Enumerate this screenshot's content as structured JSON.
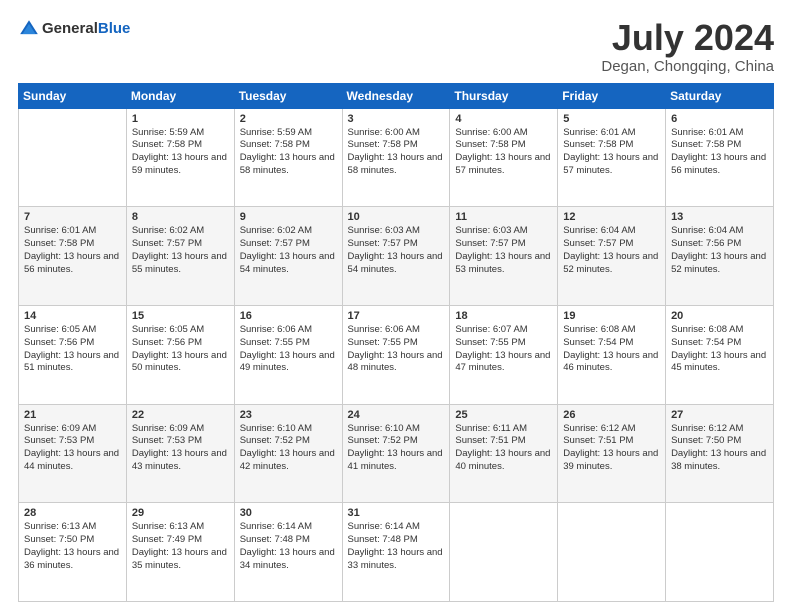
{
  "header": {
    "logo_line1": "General",
    "logo_line2": "Blue",
    "month_title": "July 2024",
    "location": "Degan, Chongqing, China"
  },
  "weekdays": [
    "Sunday",
    "Monday",
    "Tuesday",
    "Wednesday",
    "Thursday",
    "Friday",
    "Saturday"
  ],
  "weeks": [
    [
      {
        "day": "",
        "sunrise": "",
        "sunset": "",
        "daylight": ""
      },
      {
        "day": "1",
        "sunrise": "Sunrise: 5:59 AM",
        "sunset": "Sunset: 7:58 PM",
        "daylight": "Daylight: 13 hours and 59 minutes."
      },
      {
        "day": "2",
        "sunrise": "Sunrise: 5:59 AM",
        "sunset": "Sunset: 7:58 PM",
        "daylight": "Daylight: 13 hours and 58 minutes."
      },
      {
        "day": "3",
        "sunrise": "Sunrise: 6:00 AM",
        "sunset": "Sunset: 7:58 PM",
        "daylight": "Daylight: 13 hours and 58 minutes."
      },
      {
        "day": "4",
        "sunrise": "Sunrise: 6:00 AM",
        "sunset": "Sunset: 7:58 PM",
        "daylight": "Daylight: 13 hours and 57 minutes."
      },
      {
        "day": "5",
        "sunrise": "Sunrise: 6:01 AM",
        "sunset": "Sunset: 7:58 PM",
        "daylight": "Daylight: 13 hours and 57 minutes."
      },
      {
        "day": "6",
        "sunrise": "Sunrise: 6:01 AM",
        "sunset": "Sunset: 7:58 PM",
        "daylight": "Daylight: 13 hours and 56 minutes."
      }
    ],
    [
      {
        "day": "7",
        "sunrise": "Sunrise: 6:01 AM",
        "sunset": "Sunset: 7:58 PM",
        "daylight": "Daylight: 13 hours and 56 minutes."
      },
      {
        "day": "8",
        "sunrise": "Sunrise: 6:02 AM",
        "sunset": "Sunset: 7:57 PM",
        "daylight": "Daylight: 13 hours and 55 minutes."
      },
      {
        "day": "9",
        "sunrise": "Sunrise: 6:02 AM",
        "sunset": "Sunset: 7:57 PM",
        "daylight": "Daylight: 13 hours and 54 minutes."
      },
      {
        "day": "10",
        "sunrise": "Sunrise: 6:03 AM",
        "sunset": "Sunset: 7:57 PM",
        "daylight": "Daylight: 13 hours and 54 minutes."
      },
      {
        "day": "11",
        "sunrise": "Sunrise: 6:03 AM",
        "sunset": "Sunset: 7:57 PM",
        "daylight": "Daylight: 13 hours and 53 minutes."
      },
      {
        "day": "12",
        "sunrise": "Sunrise: 6:04 AM",
        "sunset": "Sunset: 7:57 PM",
        "daylight": "Daylight: 13 hours and 52 minutes."
      },
      {
        "day": "13",
        "sunrise": "Sunrise: 6:04 AM",
        "sunset": "Sunset: 7:56 PM",
        "daylight": "Daylight: 13 hours and 52 minutes."
      }
    ],
    [
      {
        "day": "14",
        "sunrise": "Sunrise: 6:05 AM",
        "sunset": "Sunset: 7:56 PM",
        "daylight": "Daylight: 13 hours and 51 minutes."
      },
      {
        "day": "15",
        "sunrise": "Sunrise: 6:05 AM",
        "sunset": "Sunset: 7:56 PM",
        "daylight": "Daylight: 13 hours and 50 minutes."
      },
      {
        "day": "16",
        "sunrise": "Sunrise: 6:06 AM",
        "sunset": "Sunset: 7:55 PM",
        "daylight": "Daylight: 13 hours and 49 minutes."
      },
      {
        "day": "17",
        "sunrise": "Sunrise: 6:06 AM",
        "sunset": "Sunset: 7:55 PM",
        "daylight": "Daylight: 13 hours and 48 minutes."
      },
      {
        "day": "18",
        "sunrise": "Sunrise: 6:07 AM",
        "sunset": "Sunset: 7:55 PM",
        "daylight": "Daylight: 13 hours and 47 minutes."
      },
      {
        "day": "19",
        "sunrise": "Sunrise: 6:08 AM",
        "sunset": "Sunset: 7:54 PM",
        "daylight": "Daylight: 13 hours and 46 minutes."
      },
      {
        "day": "20",
        "sunrise": "Sunrise: 6:08 AM",
        "sunset": "Sunset: 7:54 PM",
        "daylight": "Daylight: 13 hours and 45 minutes."
      }
    ],
    [
      {
        "day": "21",
        "sunrise": "Sunrise: 6:09 AM",
        "sunset": "Sunset: 7:53 PM",
        "daylight": "Daylight: 13 hours and 44 minutes."
      },
      {
        "day": "22",
        "sunrise": "Sunrise: 6:09 AM",
        "sunset": "Sunset: 7:53 PM",
        "daylight": "Daylight: 13 hours and 43 minutes."
      },
      {
        "day": "23",
        "sunrise": "Sunrise: 6:10 AM",
        "sunset": "Sunset: 7:52 PM",
        "daylight": "Daylight: 13 hours and 42 minutes."
      },
      {
        "day": "24",
        "sunrise": "Sunrise: 6:10 AM",
        "sunset": "Sunset: 7:52 PM",
        "daylight": "Daylight: 13 hours and 41 minutes."
      },
      {
        "day": "25",
        "sunrise": "Sunrise: 6:11 AM",
        "sunset": "Sunset: 7:51 PM",
        "daylight": "Daylight: 13 hours and 40 minutes."
      },
      {
        "day": "26",
        "sunrise": "Sunrise: 6:12 AM",
        "sunset": "Sunset: 7:51 PM",
        "daylight": "Daylight: 13 hours and 39 minutes."
      },
      {
        "day": "27",
        "sunrise": "Sunrise: 6:12 AM",
        "sunset": "Sunset: 7:50 PM",
        "daylight": "Daylight: 13 hours and 38 minutes."
      }
    ],
    [
      {
        "day": "28",
        "sunrise": "Sunrise: 6:13 AM",
        "sunset": "Sunset: 7:50 PM",
        "daylight": "Daylight: 13 hours and 36 minutes."
      },
      {
        "day": "29",
        "sunrise": "Sunrise: 6:13 AM",
        "sunset": "Sunset: 7:49 PM",
        "daylight": "Daylight: 13 hours and 35 minutes."
      },
      {
        "day": "30",
        "sunrise": "Sunrise: 6:14 AM",
        "sunset": "Sunset: 7:48 PM",
        "daylight": "Daylight: 13 hours and 34 minutes."
      },
      {
        "day": "31",
        "sunrise": "Sunrise: 6:14 AM",
        "sunset": "Sunset: 7:48 PM",
        "daylight": "Daylight: 13 hours and 33 minutes."
      },
      {
        "day": "",
        "sunrise": "",
        "sunset": "",
        "daylight": ""
      },
      {
        "day": "",
        "sunrise": "",
        "sunset": "",
        "daylight": ""
      },
      {
        "day": "",
        "sunrise": "",
        "sunset": "",
        "daylight": ""
      }
    ]
  ]
}
